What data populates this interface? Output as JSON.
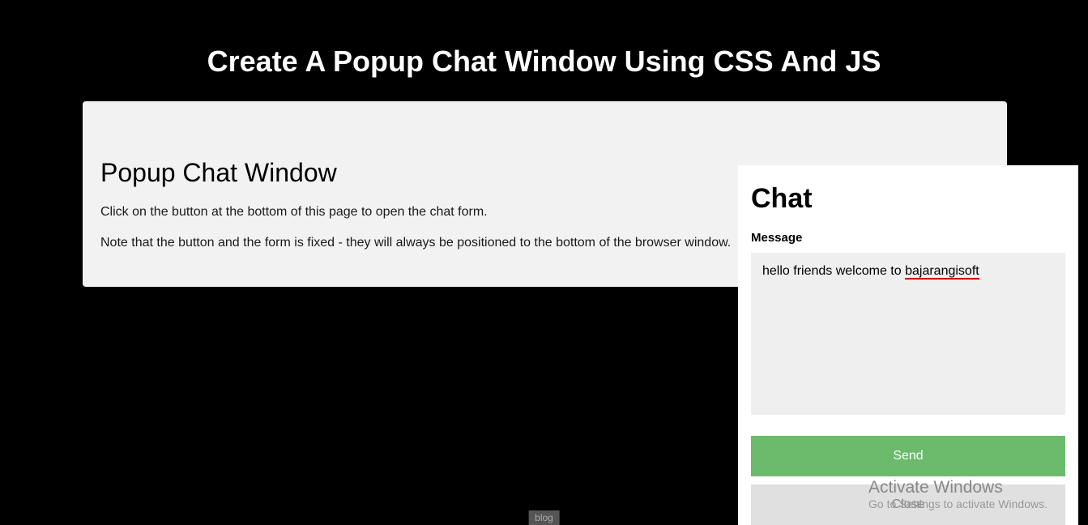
{
  "page": {
    "title": "Create A Popup Chat Window Using CSS And JS"
  },
  "card": {
    "heading": "Popup Chat Window",
    "text1": "Click on the button at the bottom of this page to open the chat form.",
    "text2": "Note that the button and the form is fixed - they will always be positioned to the bottom of the browser window."
  },
  "chat": {
    "heading": "Chat",
    "label": "Message",
    "message_prefix": "hello friends welcome to ",
    "message_underlined": "bajarangisoft",
    "send_label": "Send",
    "close_label": "Close"
  },
  "watermark": {
    "title": "Activate Windows",
    "subtitle": "Go to Settings to activate Windows."
  },
  "footer": {
    "blog_label": "blog"
  }
}
